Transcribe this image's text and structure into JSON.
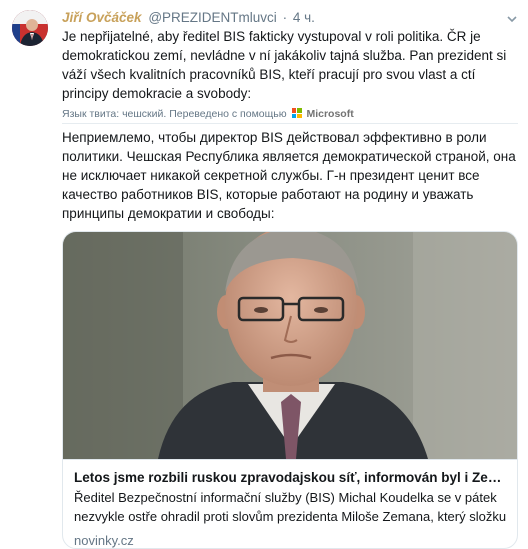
{
  "tweet": {
    "author_name": "Jiří Ovčáček",
    "handle": "@PREZIDENTmluvci",
    "separator": "·",
    "time": "4 ч.",
    "text_original": "Je nepřijatelné, aby ředitel BIS fakticky vystupoval v roli politika. ČR je demokratickou zemí, nevládne v ní jakákoliv tajná služba. Pan prezident si váží všech kvalitních pracovníků BIS, kteří pracují pro svou vlast a ctí principy demokracie a svobody:",
    "translation_note": "Язык твита: чешский. Переведено с помощью",
    "translator_brand": "Microsoft",
    "text_translated": "Неприемлемо, чтобы директор BIS действовал эффективно в роли политики. Чешская Республика является демократической страной, она не исключает никакой секретной службы. Г-н президент ценит все качество работников BIS, которые работают на родину и уважать принципы демократии и свободы:"
  },
  "card": {
    "title": "Letos jsme rozbili ruskou zpravodajskou síť, informován byl i Zeman...",
    "description": "Ředitel Bezpečnostní informační služby (BIS) Michal Koudelka se v pátek nezvykle ostře ohradil proti slovům prezidenta Miloše Zemana, který složku",
    "domain": "novinky.cz"
  },
  "icons": {
    "caret": "chevron-down-icon",
    "translator_logo": "microsoft-logo-icon"
  },
  "colors": {
    "author": "#c8a15a",
    "secondary_text": "#657786",
    "border": "#e1e8ed"
  }
}
